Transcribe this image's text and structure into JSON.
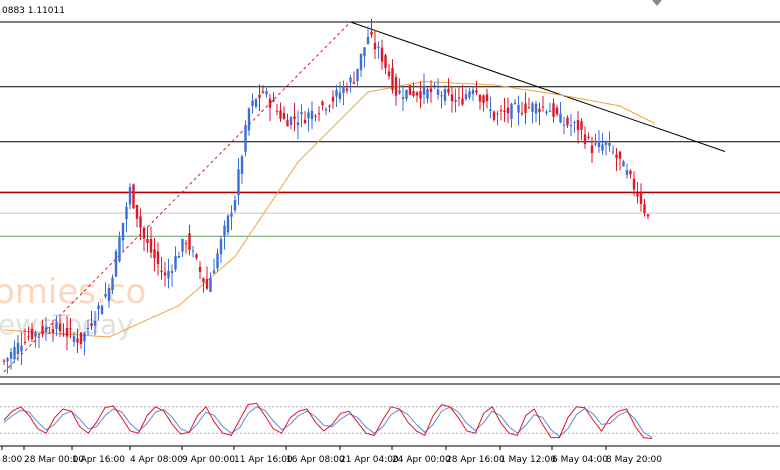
{
  "window": {
    "header_text": "0883 1.11011",
    "watermark_line1": "omies.co",
    "watermark_line2": "ewsToday"
  },
  "colors": {
    "bull_candle": "#3a6fd8",
    "bear_candle": "#e0162b",
    "moving_average": "#f4a23a",
    "trendline": "#000000",
    "fib_line": "#e0162b",
    "resistance": "#000000",
    "support_red": "#b30000",
    "support_green": "#5aa55a",
    "stoch_main": "#e0162b",
    "stoch_signal": "#5b8bd6"
  },
  "chart_data": {
    "type": "candlestick",
    "series": "price candles (4H)",
    "x_tick_labels": [
      "8:00",
      "28 Mar 00:00",
      "1 Apr 16:00",
      "4 Apr 08:00",
      "9 Apr 00:00",
      "11 Apr 16:00",
      "16 Apr 08:00",
      "21 Apr 04:00",
      "24 Apr 00:00",
      "28 Apr 16:00",
      "1 May 12:00",
      "6 May 04:00",
      "8 May 20:00"
    ],
    "y_range": [
      0,
      100
    ],
    "close_path": [
      {
        "i": 0,
        "close": 3
      },
      {
        "i": 6,
        "close": 10
      },
      {
        "i": 14,
        "close": 13
      },
      {
        "i": 22,
        "close": 9
      },
      {
        "i": 30,
        "close": 24
      },
      {
        "i": 36,
        "close": 52
      },
      {
        "i": 40,
        "close": 38
      },
      {
        "i": 46,
        "close": 27
      },
      {
        "i": 52,
        "close": 38
      },
      {
        "i": 58,
        "close": 24
      },
      {
        "i": 66,
        "close": 50
      },
      {
        "i": 70,
        "close": 75
      },
      {
        "i": 74,
        "close": 80
      },
      {
        "i": 80,
        "close": 72
      },
      {
        "i": 86,
        "close": 73
      },
      {
        "i": 94,
        "close": 78
      },
      {
        "i": 100,
        "close": 84
      },
      {
        "i": 104,
        "close": 96
      },
      {
        "i": 108,
        "close": 90
      },
      {
        "i": 112,
        "close": 80
      },
      {
        "i": 118,
        "close": 80
      },
      {
        "i": 124,
        "close": 80
      },
      {
        "i": 130,
        "close": 77
      },
      {
        "i": 134,
        "close": 82
      },
      {
        "i": 140,
        "close": 73
      },
      {
        "i": 146,
        "close": 75
      },
      {
        "i": 152,
        "close": 76
      },
      {
        "i": 156,
        "close": 75
      },
      {
        "i": 160,
        "close": 71
      },
      {
        "i": 164,
        "close": 70
      },
      {
        "i": 168,
        "close": 64
      },
      {
        "i": 172,
        "close": 65
      },
      {
        "i": 176,
        "close": 60
      },
      {
        "i": 180,
        "close": 53
      },
      {
        "i": 182,
        "close": 49
      },
      {
        "i": 184,
        "close": 44
      }
    ],
    "moving_average": [
      {
        "i": 0,
        "value": 12
      },
      {
        "i": 30,
        "value": 10
      },
      {
        "i": 50,
        "value": 19
      },
      {
        "i": 66,
        "value": 33
      },
      {
        "i": 84,
        "value": 60
      },
      {
        "i": 104,
        "value": 80
      },
      {
        "i": 120,
        "value": 83
      },
      {
        "i": 140,
        "value": 82
      },
      {
        "i": 160,
        "value": 79
      },
      {
        "i": 176,
        "value": 76
      },
      {
        "i": 186,
        "value": 71
      }
    ],
    "horizontal_levels": [
      {
        "name": "top",
        "value": 100,
        "color": "#000000"
      },
      {
        "name": "resistance_1",
        "value": 81.5,
        "color": "#000000"
      },
      {
        "name": "resistance_2",
        "value": 65.8,
        "color": "#000000"
      },
      {
        "name": "support_red",
        "value": 51.3,
        "color": "#b30000"
      },
      {
        "name": "support_grey",
        "value": 45.4,
        "color": "#c8c8c8"
      },
      {
        "name": "support_green",
        "value": 38.8,
        "color": "#5aa55a"
      }
    ],
    "trendline": {
      "from": {
        "i": 99,
        "value": 100
      },
      "to": {
        "i": 206,
        "value": 63
      }
    },
    "fib_line": {
      "from": {
        "i": 0,
        "value": 0
      },
      "to": {
        "i": 99,
        "value": 100
      }
    },
    "stochastic": {
      "range": [
        0,
        100
      ],
      "levels": [
        80,
        20
      ],
      "main": [
        50,
        70,
        80,
        60,
        30,
        20,
        55,
        75,
        70,
        35,
        20,
        45,
        78,
        82,
        55,
        25,
        20,
        60,
        80,
        70,
        40,
        18,
        22,
        60,
        80,
        45,
        20,
        15,
        50,
        85,
        88,
        60,
        30,
        20,
        55,
        70,
        75,
        45,
        25,
        40,
        65,
        70,
        45,
        20,
        15,
        50,
        80,
        75,
        45,
        25,
        15,
        60,
        85,
        80,
        55,
        25,
        20,
        65,
        80,
        45,
        20,
        15,
        60,
        75,
        40,
        10,
        10,
        55,
        80,
        78,
        50,
        25,
        55,
        70,
        75,
        35,
        10,
        8
      ],
      "signal": [
        45,
        60,
        72,
        68,
        45,
        28,
        40,
        62,
        70,
        52,
        30,
        35,
        60,
        75,
        68,
        42,
        25,
        42,
        68,
        74,
        56,
        30,
        22,
        42,
        68,
        60,
        35,
        20,
        32,
        65,
        80,
        72,
        48,
        28,
        40,
        60,
        70,
        58,
        38,
        35,
        52,
        64,
        56,
        34,
        20,
        34,
        62,
        74,
        62,
        40,
        22,
        40,
        70,
        80,
        68,
        42,
        26,
        44,
        70,
        60,
        35,
        20,
        38,
        62,
        56,
        28,
        12,
        30,
        62,
        76,
        64,
        40,
        42,
        60,
        70,
        52,
        22,
        10
      ]
    }
  }
}
